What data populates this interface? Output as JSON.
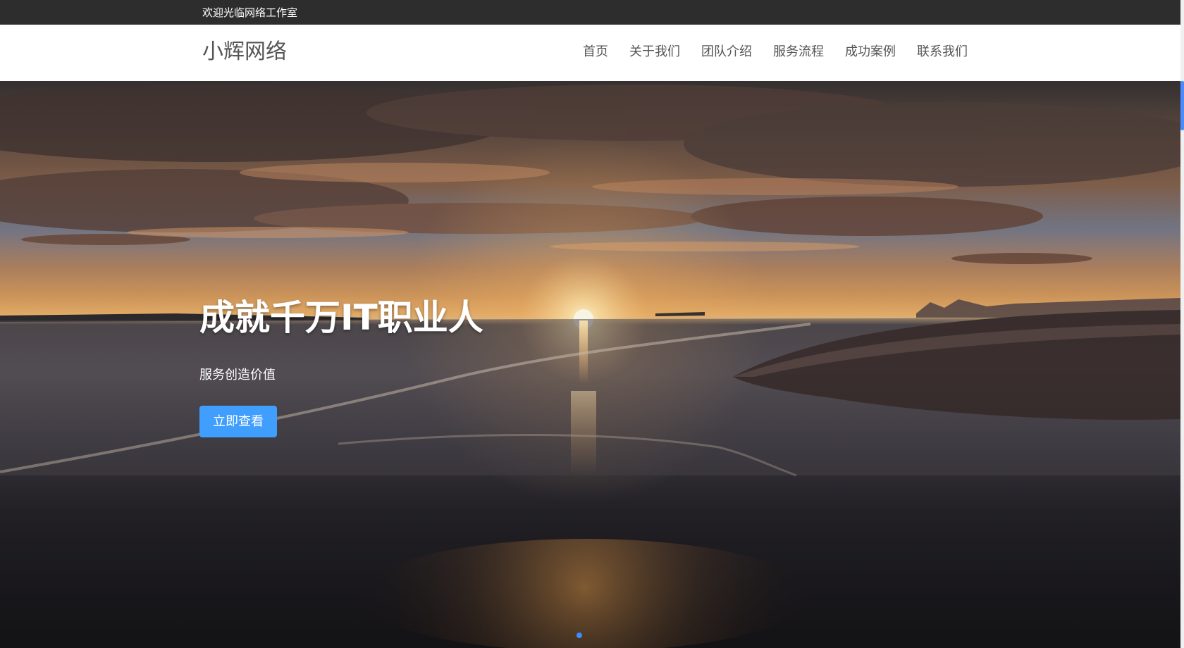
{
  "topbar": {
    "welcome_text": "欢迎光临网络工作室"
  },
  "header": {
    "logo_text": "小辉网络",
    "nav": [
      {
        "label": "首页"
      },
      {
        "label": "关于我们"
      },
      {
        "label": "团队介绍"
      },
      {
        "label": "服务流程"
      },
      {
        "label": "成功案例"
      },
      {
        "label": "联系我们"
      }
    ]
  },
  "hero": {
    "title": "成就千万IT职业人",
    "subtitle": "服务创造价值",
    "button_label": "立即查看",
    "active_slide_color": "#3a8cff"
  },
  "colors": {
    "button": "#409efe",
    "topbar_bg": "#2d2d2d",
    "header_bg": "#ffffff",
    "nav_text": "#555555"
  }
}
